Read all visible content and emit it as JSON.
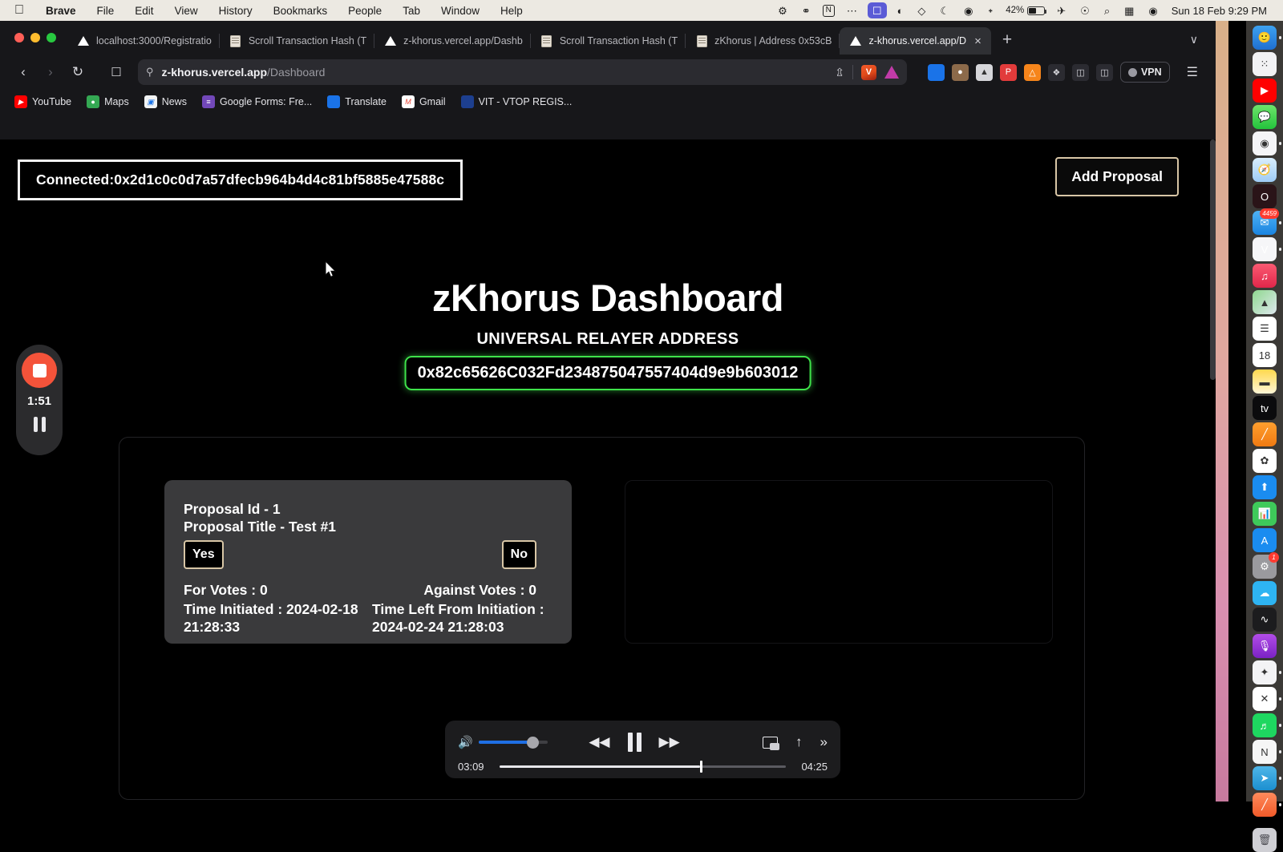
{
  "menubar": {
    "apple": "",
    "items": [
      "Brave",
      "File",
      "Edit",
      "View",
      "History",
      "Bookmarks",
      "People",
      "Tab",
      "Window",
      "Help"
    ],
    "status_icons": [
      "gear-icon",
      "vpn-shield-icon",
      "notion-icon",
      "dots-icon",
      "screen-share-icon",
      "moon-contrast-icon",
      "dropbox-icon",
      "night-shift-icon",
      "timer-icon",
      "bluetooth-icon"
    ],
    "battery_percent": "42%",
    "right_icons": [
      "wifi-icon",
      "microphone-icon",
      "search-icon",
      "control-center-icon",
      "siri-icon"
    ],
    "clock": "Sun 18 Feb  9:29 PM"
  },
  "browser": {
    "tabs": [
      {
        "label": "localhost:3000/Registratio",
        "favicon": "vercel",
        "active": false
      },
      {
        "label": "Scroll Transaction Hash (T",
        "favicon": "doc",
        "active": false
      },
      {
        "label": "z-khorus.vercel.app/Dashb",
        "favicon": "vercel",
        "active": false
      },
      {
        "label": "Scroll Transaction Hash (T",
        "favicon": "doc",
        "active": false
      },
      {
        "label": "zKhorus | Address 0x53cB",
        "favicon": "doc",
        "active": false
      },
      {
        "label": "z-khorus.vercel.app/D",
        "favicon": "vercel",
        "active": true
      }
    ],
    "new_tab_label": "+",
    "tab_list_label": "∨",
    "close_label": "×",
    "nav": {
      "back": "‹",
      "forward": "›",
      "reload": "↻",
      "bookmark": "☐"
    },
    "omnibox": {
      "domain": "z-khorus.vercel.app",
      "path": "/Dashboard",
      "shield_icon": "site-settings-icon",
      "share_icon": "share-icon",
      "brave_shields_label": "V",
      "triangle_icon": "vercel-icon"
    },
    "extensions": [
      "translate-ext",
      "adblock-off-ext",
      "keplr-ext",
      "phantom-ext",
      "metamask-ext",
      "puzzle-ext",
      "sidebar-ext",
      "window-ext"
    ],
    "vpn_label": "VPN",
    "menu_label": "☰",
    "bookmarks": [
      {
        "label": "YouTube",
        "color": "#ff0000",
        "glyph": "▶"
      },
      {
        "label": "Maps",
        "color": "#34a853",
        "glyph": "◉"
      },
      {
        "label": "News",
        "color": "#4285f4",
        "glyph": "▤"
      },
      {
        "label": "Google Forms: Fre...",
        "color": "#7248b9",
        "glyph": "≡"
      },
      {
        "label": "Translate",
        "color": "#1a73e8",
        "glyph": "文"
      },
      {
        "label": "Gmail",
        "color": "#ea4335",
        "glyph": "M"
      },
      {
        "label": "VIT - VTOP REGIS...",
        "color": "#1d3f8f",
        "glyph": ""
      }
    ]
  },
  "page": {
    "connected_label": "Connected:0x2d1c0c0d7a57dfecb964b4d4c81bf5885e47588c",
    "add_proposal_label": "Add Proposal",
    "title": "zKhorus Dashboard",
    "relayer_heading": "UNIVERSAL RELAYER ADDRESS",
    "relayer_address": "0x82c65626C032Fd234875047557404d9e9b603012",
    "accent_green": "#3ee24a",
    "accent_tan": "#d8c6a6",
    "proposals": [
      {
        "id_line": "Proposal Id - 1",
        "title_line": "Proposal Title - Test #1",
        "yes_label": "Yes",
        "no_label": "No",
        "for_votes": "For Votes : 0",
        "against_votes": "Against Votes : 0",
        "time_initiated": "Time Initiated : 2024-02-18 21:28:33",
        "time_left": "Time Left From Initiation : 2024-02-24 21:28:03"
      }
    ]
  },
  "recorder": {
    "stop_label": "stop-recording-icon",
    "elapsed": "1:51",
    "pause_label": "pause-recording-icon"
  },
  "player": {
    "volume_icon": "speaker-icon",
    "rewind_icon": "◀◀",
    "pause_icon": "pause-icon",
    "forward_icon": "▶▶",
    "pip_icon": "picture-in-picture-icon",
    "share_icon": "↑",
    "more_icon": "»",
    "current_time": "03:09",
    "total_time": "04:25",
    "progress_percent": 70,
    "volume_percent": 78
  },
  "dock": {
    "apps": [
      {
        "name": "finder",
        "glyph": "🙂",
        "bg": "linear-gradient(180deg,#3ea2f0,#1f6fd0)",
        "running": true
      },
      {
        "name": "launchpad",
        "glyph": "⁙",
        "bg": "#f2f2f4",
        "running": false
      },
      {
        "name": "youtube",
        "glyph": "▶",
        "bg": "#ff0000",
        "running": false
      },
      {
        "name": "messages",
        "glyph": "💬",
        "bg": "linear-gradient(180deg,#6ee36b,#23c33c)",
        "running": false
      },
      {
        "name": "chrome",
        "glyph": "◉",
        "bg": "#f5f5f7",
        "running": true
      },
      {
        "name": "safari",
        "glyph": "🧭",
        "bg": "linear-gradient(180deg,#d9eefc,#9ecbf5)",
        "running": false
      },
      {
        "name": "opera",
        "glyph": "O",
        "bg": "#2a1418",
        "running": false
      },
      {
        "name": "mail",
        "glyph": "✉",
        "bg": "linear-gradient(180deg,#4fb3f5,#1a84e0)",
        "running": true,
        "badge": "4459"
      },
      {
        "name": "brave",
        "glyph": "V",
        "bg": "#f6f6f8",
        "running": true
      },
      {
        "name": "music",
        "glyph": "♫",
        "bg": "linear-gradient(180deg,#fb5a72,#e0264a)",
        "running": false
      },
      {
        "name": "maps",
        "glyph": "▲",
        "bg": "linear-gradient(135deg,#8fd88f,#dfe8ee)",
        "running": false
      },
      {
        "name": "reminders",
        "glyph": "☰",
        "bg": "#ffffff",
        "running": false
      },
      {
        "name": "calendar",
        "glyph": "18",
        "bg": "#ffffff",
        "running": false
      },
      {
        "name": "notes",
        "glyph": "▬",
        "bg": "linear-gradient(180deg,#ffd84d,#fff6d6)",
        "running": false
      },
      {
        "name": "appletv",
        "glyph": "tv",
        "bg": "#0b0b0d",
        "running": false
      },
      {
        "name": "freeform",
        "glyph": "╱",
        "bg": "linear-gradient(180deg,#ff9f2e,#f07a12)",
        "running": false
      },
      {
        "name": "photos",
        "glyph": "✿",
        "bg": "#ffffff",
        "running": false
      },
      {
        "name": "keynote",
        "glyph": "⬆",
        "bg": "#1a8cf0",
        "running": false
      },
      {
        "name": "numbers",
        "glyph": "📊",
        "bg": "#3ec95a",
        "running": false
      },
      {
        "name": "appstore",
        "glyph": "A",
        "bg": "#1a8cf0",
        "running": false
      },
      {
        "name": "settings",
        "glyph": "⚙",
        "bg": "#9a9a9e",
        "running": false,
        "badge": "1"
      },
      {
        "name": "files",
        "glyph": "☁",
        "bg": "#2eb4f2",
        "running": false
      },
      {
        "name": "audio",
        "glyph": "∿",
        "bg": "#1c1c1e",
        "running": false
      },
      {
        "name": "podcasts",
        "glyph": "🎙",
        "bg": "linear-gradient(180deg,#b24de8,#7b22c4)",
        "running": false
      },
      {
        "name": "sketch",
        "glyph": "✦",
        "bg": "#f3f3f5",
        "running": true
      },
      {
        "name": "vscode",
        "glyph": "✕",
        "bg": "#ffffff",
        "running": true
      },
      {
        "name": "spotify",
        "glyph": "♬",
        "bg": "#1ed760",
        "running": true
      },
      {
        "name": "notion",
        "glyph": "N",
        "bg": "#f6f6f6",
        "running": true
      },
      {
        "name": "telegram",
        "glyph": "➤",
        "bg": "linear-gradient(180deg,#4fb6e8,#1c8fd0)",
        "running": true
      },
      {
        "name": "highlight",
        "glyph": "╱",
        "bg": "linear-gradient(180deg,#ff8a5c,#f15a29)",
        "running": true
      }
    ],
    "trash_label": "trash-icon"
  }
}
